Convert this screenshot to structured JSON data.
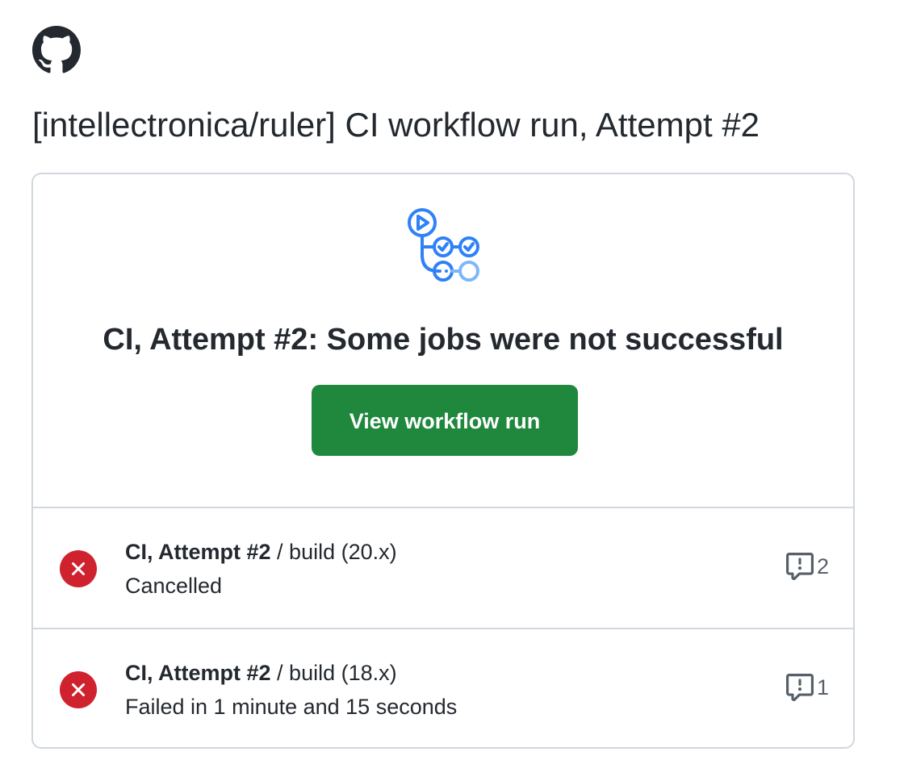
{
  "header": {
    "logo_icon": "github-mark-icon",
    "title": "[intellectronica/ruler] CI workflow run, Attempt #2"
  },
  "hero": {
    "icon": "github-actions-workflow-icon",
    "summary": "CI, Attempt #2: Some jobs were not successful",
    "button_label": "View workflow run"
  },
  "jobs": [
    {
      "status_icon": "x-circle-fill-icon",
      "name": "CI, Attempt #2",
      "separator": " / ",
      "job": "build (20.x)",
      "status_text": "Cancelled",
      "annotation_icon": "report-icon",
      "annotation_count": "2"
    },
    {
      "status_icon": "x-circle-fill-icon",
      "name": "CI, Attempt #2",
      "separator": " / ",
      "job": "build (18.x)",
      "status_text": "Failed in 1 minute and 15 seconds",
      "annotation_icon": "report-icon",
      "annotation_count": "1"
    }
  ],
  "colors": {
    "button_bg": "#1f883d",
    "failure_red": "#cf222e",
    "actions_blue": "#2f81f7",
    "border": "#d0d7de",
    "text": "#24292f",
    "muted": "#57606a"
  }
}
